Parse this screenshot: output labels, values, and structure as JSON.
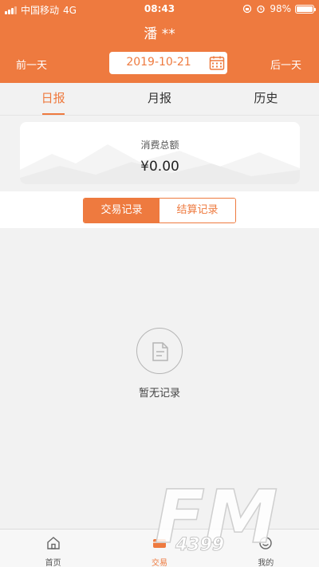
{
  "status_bar": {
    "carrier": "中国移动",
    "network": "4G",
    "time": "08:43",
    "battery": "98%",
    "battery_level": 0.98
  },
  "header": {
    "title": "潘 **",
    "prev_day": "前一天",
    "next_day": "后一天",
    "date": "2019-10-21"
  },
  "tabs": [
    {
      "label": "日报"
    },
    {
      "label": "月报"
    },
    {
      "label": "历史"
    }
  ],
  "summary": {
    "label": "消费总额",
    "value": "¥0.00"
  },
  "segments": [
    {
      "label": "交易记录"
    },
    {
      "label": "结算记录"
    }
  ],
  "empty": {
    "text": "暂无记录"
  },
  "tabbar": [
    {
      "label": "首页"
    },
    {
      "label": "交易"
    },
    {
      "label": "我的"
    }
  ],
  "watermark": {
    "text": "FM",
    "sub": "4399"
  },
  "colors": {
    "accent": "#ee7a3f",
    "background": "#f2f2f2"
  }
}
